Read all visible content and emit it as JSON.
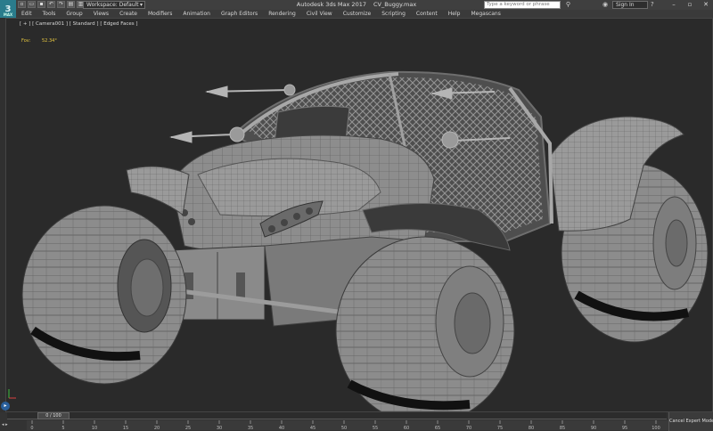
{
  "app": {
    "title": "Autodesk 3ds Max 2017",
    "file_name": "CV_Buggy.max",
    "logo_text": "3",
    "logo_sub": "MAX"
  },
  "toolbar": {
    "workspace_label": "Workspace: Default",
    "search_placeholder": "Type a keyword or phrase",
    "signin_label": "Sign In"
  },
  "menu": [
    "Edit",
    "Tools",
    "Group",
    "Views",
    "Create",
    "Modifiers",
    "Animation",
    "Graph Editors",
    "Rendering",
    "Civil View",
    "Customize",
    "Scripting",
    "Content",
    "Help",
    "Megascans"
  ],
  "viewport": {
    "label": "[ + ] [ Camera001 ] [ Standard ] [ Edged Faces ]",
    "fov_label": "Fov:",
    "fov_value": "52.34°"
  },
  "timeline": {
    "frame_label": "0 / 100",
    "track_ticks": [
      "0",
      "5",
      "10",
      "15",
      "20",
      "25",
      "30",
      "35",
      "40",
      "45",
      "50",
      "55",
      "60",
      "65",
      "70",
      "75",
      "80",
      "85",
      "90",
      "95",
      "100"
    ],
    "cancel_label": "Cancel Expert Mode"
  },
  "colors": {
    "logo": "#2a7c8c",
    "viewport_bg": "#2a2a2a",
    "fov_text": "#e8c840",
    "mesh_fill": "#8a8a8a",
    "mesh_line": "#505050"
  }
}
